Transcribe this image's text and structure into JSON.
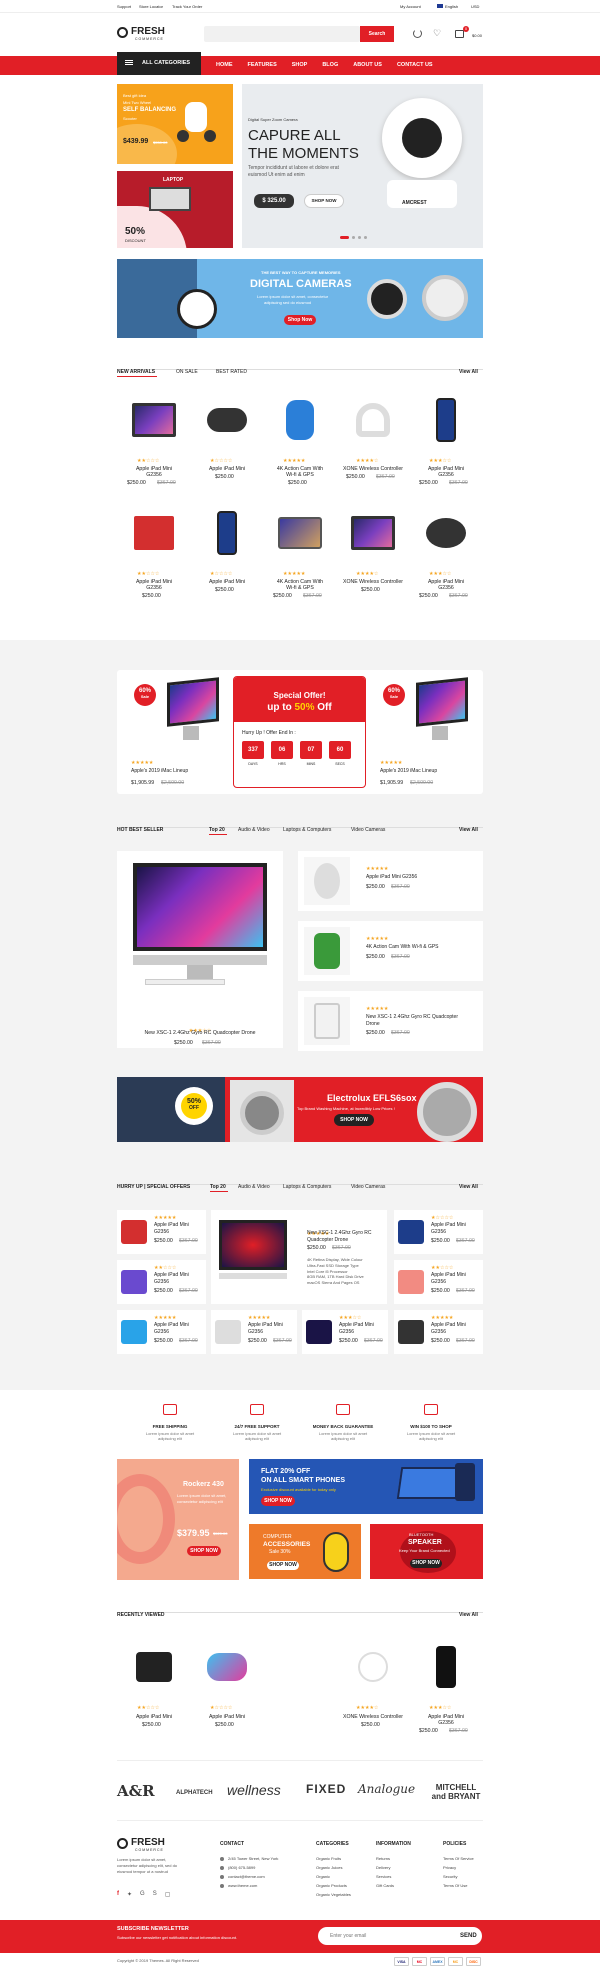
{
  "topbar": {
    "support": "Support",
    "store": "Store Locator",
    "track": "Track Your Order",
    "account": "My Account",
    "language": "English",
    "currency": "USD"
  },
  "logo": {
    "name": "FRESH",
    "sub": "COMMERCE"
  },
  "search": {
    "placeholder": "",
    "button": "Search"
  },
  "cart": {
    "count": "0",
    "total": "$0.00"
  },
  "nav": {
    "all_categories": "ALL CATEGORIES",
    "items": [
      "HOME",
      "FEATURES",
      "SHOP",
      "BLOG",
      "ABOUT US",
      "CONTACT US"
    ]
  },
  "promo1": {
    "line1": "Best gift idea",
    "line2": "Mini Two Wheel",
    "line3": "SELF BALANCING",
    "line4": "Scooter",
    "price": "$439.99",
    "old": "$550.00"
  },
  "promo2": {
    "title": "LAPTOP",
    "pct": "50%",
    "sub": "DISCOUNT"
  },
  "hero": {
    "tag": "Digital Super Zoom Camera",
    "title1": "CAPURE ALL",
    "title2": "THE MOMENTS",
    "desc1": "Tempor incididunt ut labore et dolore  erat",
    "desc2": "euismod Ut enim ad enim",
    "price": "$ 325.00",
    "button": "SHOP NOW",
    "brand": "AMCREST"
  },
  "banner": {
    "tag": "THE BEST WAY TO CAPTURE MEMORIES",
    "title": "DIGITAL CAMERAS",
    "desc1": "Lorem ipsum dolor sit amet, consectetur",
    "desc2": "adipiscing sed do eiusmod",
    "button": "Shop Now"
  },
  "tabs1": {
    "items": [
      "NEW ARRIVALS",
      "ON SALE",
      "BEST RATED"
    ],
    "view_all": "View All"
  },
  "products1": [
    {
      "name": "Apple iPad Mini",
      "name2": "G2356",
      "price": "$250.00",
      "old": "$367.00",
      "stars": "★★☆☆☆",
      "icon": "imac-icon"
    },
    {
      "name": "Apple iPad Mini",
      "name2": "",
      "price": "$250.00",
      "old": "",
      "stars": "★☆☆☆☆",
      "icon": "gamepad-icon"
    },
    {
      "name": "4K Action Cam With",
      "name2": "Wi-fi & GPS",
      "price": "$250.00",
      "old": "",
      "stars": "★★★★★",
      "icon": "speaker-icon"
    },
    {
      "name": "XONE Wireless Controller",
      "name2": "",
      "price": "$250.00",
      "old": "$367.00",
      "stars": "★★★★☆",
      "icon": "headphones-icon"
    },
    {
      "name": "Apple iPad Mini",
      "name2": "G2356",
      "price": "$250.00",
      "old": "$367.00",
      "stars": "★★★☆☆",
      "icon": "phone-icon"
    },
    {
      "name": "Apple iPad Mini",
      "name2": "G2356",
      "price": "$250.00",
      "old": "",
      "stars": "★★☆☆☆",
      "icon": "speakers-icon"
    },
    {
      "name": "Apple iPad Mini",
      "name2": "",
      "price": "$250.00",
      "old": "",
      "stars": "★☆☆☆☆",
      "icon": "phone-icon"
    },
    {
      "name": "4K Action Cam With",
      "name2": "Wi-fi & GPS",
      "price": "$250.00",
      "old": "$367.00",
      "stars": "★★★★★",
      "icon": "laptop-icon"
    },
    {
      "name": "XONE Wireless Controller",
      "name2": "",
      "price": "$250.00",
      "old": "",
      "stars": "★★★★☆",
      "icon": "imac-icon"
    },
    {
      "name": "Apple iPad Mini",
      "name2": "G2356",
      "price": "$250.00",
      "old": "$367.00",
      "stars": "★★★☆☆",
      "icon": "earbuds-icon"
    }
  ],
  "deal": {
    "badge_pct": "60%",
    "badge_off": "Sale",
    "name": "Apple's 2019 iMac Lineup",
    "price": "$1,905.99",
    "old": "$2,500.00",
    "stars": "★★★★★",
    "special": "Special Offer!",
    "upto": "up to",
    "pct": "50%",
    "off": "Off",
    "hurry": "Hurry Up ! Offer End In :",
    "timer": [
      {
        "v": "337",
        "l": "DAYS"
      },
      {
        "v": "06",
        "l": "HRS"
      },
      {
        "v": "07",
        "l": "MINS"
      },
      {
        "v": "60",
        "l": "SECS"
      }
    ]
  },
  "tabs2": {
    "title": "HOT BEST SELLER",
    "items": [
      "Top 20",
      "Audio & Video",
      "Laptops & Computers",
      "Video Cameras"
    ],
    "view_all": "View All"
  },
  "bestseller_main": {
    "name": "New XSC-1 2.4Ghz Gyro RC Quadcopter Drone",
    "price": "$250.00",
    "old": "$367.00",
    "stars": "★★★☆☆"
  },
  "bestseller_list": [
    {
      "name": "Apple iPad Mini G2356",
      "price": "$250.00",
      "old": "$367.00",
      "stars": "★★★★★"
    },
    {
      "name": "4K Action Cam With Wi-fi & GPS",
      "price": "$250.00",
      "old": "$367.00",
      "stars": "★★★★★"
    },
    {
      "name": "New XSC-1 2.4Ghz Gyro RC Quadcopter",
      "name2": "Drone",
      "price": "$250.00",
      "old": "$367.00",
      "stars": "★★★★★"
    }
  ],
  "electrolux": {
    "pct": "50%",
    "off": "OFF",
    "title": "Electrolux EFLS6sox",
    "sub": "Top Brand Washing Machine, at Incredibly Low Prices !",
    "button": "SHOP NOW"
  },
  "tabs3": {
    "title": "HURRY UP | SPECIAL OFFERS",
    "items": [
      "Top 20",
      "Audio & Video",
      "Laptops & Computers",
      "Video Cameras"
    ],
    "view_all": "View All"
  },
  "special": [
    {
      "name": "Apple iPad Mini",
      "name2": "G2356",
      "price": "$250.00",
      "old": "$367.00",
      "stars": "★★★★★"
    },
    {
      "name": "Apple iPad Mini",
      "name2": "G2356",
      "price": "$250.00",
      "old": "$367.00",
      "stars": "★★☆☆☆"
    },
    {
      "name": "Apple iPad Mini",
      "name2": "G2356",
      "price": "$250.00",
      "old": "$367.00",
      "stars": "★★★★★"
    },
    {
      "name": "New XSC-1 2.4Ghz Gyro RC",
      "name2": "Quadcopter Drone",
      "price": "$250.00",
      "old": "$367.00",
      "stars": "★★★★★"
    },
    {
      "name": "Apple iPad Mini",
      "name2": "G2356",
      "price": "$250.00",
      "old": "$367.00",
      "stars": "★☆☆☆☆"
    },
    {
      "name": "Apple iPad Mini",
      "name2": "G2356",
      "price": "$250.00",
      "old": "$367.00",
      "stars": "★★☆☆☆"
    },
    {
      "name": "Apple iPad Mini",
      "name2": "G2356",
      "price": "$250.00",
      "old": "$367.00",
      "stars": "★★★★★"
    },
    {
      "name": "Apple iPad Mini",
      "name2": "G2356",
      "price": "$250.00",
      "old": "$367.00",
      "stars": "★★★☆☆"
    },
    {
      "name": "Apple iPad Mini",
      "name2": "G2356",
      "price": "$250.00",
      "old": "$367.00",
      "stars": "★★★★★"
    },
    {
      "name": "Apple iPad Mini",
      "name2": "G2356",
      "price": "$250.00",
      "old": "$367.00",
      "stars": "★★★★☆"
    }
  ],
  "specs": [
    "4K Retina Display, Wide Colour",
    "Ultra-Fast SSD Storage Type",
    "Intel Core i5 Processor",
    "8GB RAM, 1TB Hard Disk Drive",
    "macOS Sierra And Pages OS"
  ],
  "features": [
    {
      "title": "FREE SHIPPING",
      "desc1": "Lorem ipsum dolor sit amet",
      "desc2": "adipiscing elit",
      "icon": "truck-icon"
    },
    {
      "title": "24/7 FREE SUPPORT",
      "desc1": "Lorem ipsum dolor sit amet",
      "desc2": "adipiscing elit",
      "icon": "headset-icon"
    },
    {
      "title": "MONEY BACK GUARANTEE",
      "desc1": "Lorem ipsum dolor sit amet",
      "desc2": "adipiscing elit",
      "icon": "shield-icon"
    },
    {
      "title": "WIN $100 TO SHOP",
      "desc1": "Lorem ipsum dolor sit amet",
      "desc2": "adipiscing elit",
      "icon": "gift-icon"
    }
  ],
  "promo_rockerz": {
    "title": "Rockerz 430",
    "d1": "Lorem ipsum dolor sit amet,",
    "d2": "consectetur adipiscing elit",
    "price": "$379.95",
    "old": "$520.00",
    "button": "SHOP NOW"
  },
  "promo_phones": {
    "title1": "FLAT 20% OFF",
    "title2": "ON ALL SMART PHONES",
    "sub": "Exclusive discount available for today only",
    "button": "SHOP NOW"
  },
  "promo_acc": {
    "l1": "COMPUTER",
    "l2": "ACCESSORIES",
    "l3": "Sale 30%",
    "button": "SHOP NOW"
  },
  "promo_speaker": {
    "l1": "BLUETOOTH",
    "l2": "SPEAKER",
    "l3": "Keep Your Brand Connected",
    "button": "SHOP NOW"
  },
  "recent": {
    "title": "RECENTLY VIEWED",
    "view_all": "View All",
    "items": [
      {
        "name": "Apple iPad Mini",
        "price": "$250.00",
        "stars": "★★☆☆☆"
      },
      {
        "name": "Apple iPad Mini",
        "price": "$250.00",
        "stars": "★☆☆☆☆"
      },
      {
        "name": "XONE Wireless Controller",
        "price": "$250.00",
        "stars": "★★★★☆"
      },
      {
        "name": "Apple iPad Mini",
        "name2": "G2356",
        "price": "$250.00",
        "old": "$367.00",
        "stars": "★★★☆☆"
      }
    ]
  },
  "brands": [
    "A&R",
    "ALPHATECH",
    "wellness",
    "FIXED",
    "Analogue",
    "MITCHELL and BRYANT"
  ],
  "footer": {
    "about1": "Lorem ipsum dolor sit amet,",
    "about2": "consectetur adipiscing elit, sed do",
    "about3": "eiusmod tempor ut a nostrud",
    "contact_title": "CONTACT",
    "contact": [
      "2/45 Tower Street, New York",
      "(800) 675-5899",
      "contact@theme.com",
      "www.theme.com"
    ],
    "cat_title": "CATEGORIES",
    "cats": [
      "Organic Fruits",
      "Organic Juices",
      "Organic",
      "Organic Products",
      "Organic Vegetables"
    ],
    "info_title": "INFORMATION",
    "info": [
      "Returns",
      "Delivery",
      "Services",
      "Gift Cards"
    ],
    "pol_title": "POLICIES",
    "pol": [
      "Terms Of Service",
      "Privacy",
      "Security",
      "Terms Of Use"
    ]
  },
  "newsletter": {
    "title": "SUBSCRIBE NEWSLETTER",
    "desc": "Subscribe our newsletter get notification about information discount.",
    "placeholder": "Enter your email",
    "button": "SEND"
  },
  "copyright": "Copyright © 2019 Themes. All Right Reserved",
  "payments": [
    "VISA",
    "MC",
    "AMEX",
    "MC",
    "DISC"
  ],
  "colors": {
    "accent": "#e11f26",
    "dark": "#222222"
  }
}
